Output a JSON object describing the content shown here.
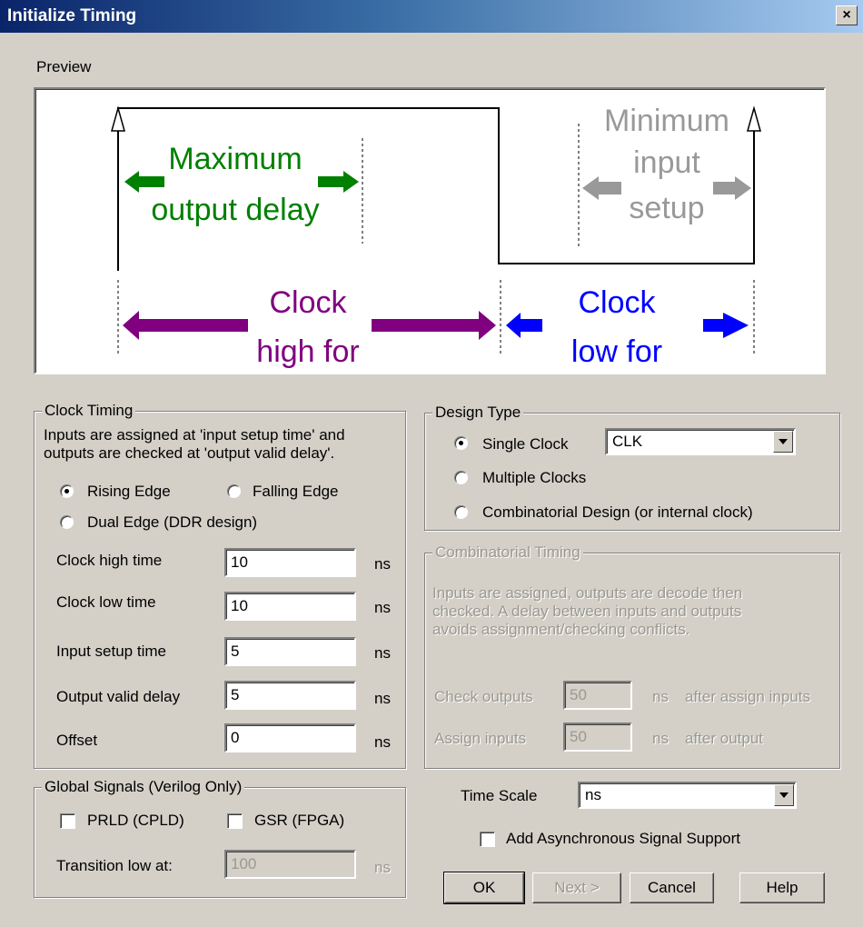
{
  "window": {
    "title": "Initialize Timing",
    "close": "×"
  },
  "preview": {
    "label": "Preview",
    "max_output_1": "Maximum",
    "max_output_2": "output delay",
    "min_setup_1": "Minimum",
    "min_setup_2": "input",
    "min_setup_3": "setup",
    "clock_high_1": "Clock",
    "clock_high_2": "high for",
    "clock_low_1": "Clock",
    "clock_low_2": "low for",
    "colors": {
      "green": "#008000",
      "gray": "#999999",
      "purple": "#800080",
      "blue": "#0000ff"
    }
  },
  "clock_timing": {
    "title": "Clock Timing",
    "desc_1": "Inputs are assigned at 'input setup time' and",
    "desc_2": "outputs are checked at 'output valid delay'.",
    "rising_edge": "Rising Edge",
    "falling_edge": "Falling Edge",
    "dual_edge": "Dual Edge (DDR design)",
    "selected_edge": "Rising Edge",
    "rows": [
      {
        "label": "Clock high time",
        "value": "10",
        "unit": "ns"
      },
      {
        "label": "Clock low time",
        "value": "10",
        "unit": "ns"
      },
      {
        "label": "Input setup time",
        "value": "5",
        "unit": "ns"
      },
      {
        "label": "Output valid delay",
        "value": "5",
        "unit": "ns"
      },
      {
        "label": "Offset",
        "value": "0",
        "unit": "ns"
      }
    ]
  },
  "design_type": {
    "title": "Design Type",
    "single_clock": "Single Clock",
    "clock_select": "CLK",
    "multiple_clocks": "Multiple Clocks",
    "combinatorial": "Combinatorial Design (or internal clock)",
    "selected": "Single Clock"
  },
  "combinatorial_timing": {
    "title": "Combinatorial Timing",
    "desc_1": "Inputs are assigned, outputs are decode then",
    "desc_2": "checked.  A delay between inputs and outputs",
    "desc_3": "avoids assignment/checking conflicts.",
    "check_label": "Check outputs",
    "check_value": "50",
    "check_unit": "ns",
    "check_suffix": "after assign inputs",
    "assign_label": "Assign inputs",
    "assign_value": "50",
    "assign_unit": "ns",
    "assign_suffix": "after output"
  },
  "global_signals": {
    "title": "Global Signals (Verilog Only)",
    "prld": "PRLD (CPLD)",
    "gsr": "GSR (FPGA)",
    "transition_label": "Transition low at:",
    "transition_value": "100",
    "transition_unit": "ns"
  },
  "time_scale": {
    "label": "Time Scale",
    "value": "ns"
  },
  "async_support": "Add Asynchronous Signal Support",
  "buttons": {
    "ok": "OK",
    "next": "Next >",
    "cancel": "Cancel",
    "help": "Help"
  }
}
